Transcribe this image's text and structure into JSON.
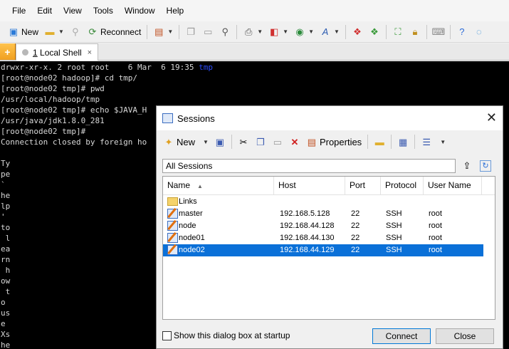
{
  "menubar": [
    "File",
    "Edit",
    "View",
    "Tools",
    "Window",
    "Help"
  ],
  "toolbar": {
    "new_label": "New",
    "reconnect_label": "Reconnect"
  },
  "tab": {
    "number": "1",
    "label": " Local Shell",
    "close": "×"
  },
  "terminal": {
    "lines": [
      "drwxr-xr-x. 2 root root    6 Mar  6 19:35 ",
      "[root@node02 hadoop]# cd tmp/",
      "[root@node02 tmp]# pwd",
      "/usr/local/hadoop/tmp",
      "[root@node02 tmp]# echo $JAVA_H",
      "/usr/java/jdk1.8.0_281",
      "[root@node02 tmp]#",
      "Connection closed by foreign ho"
    ],
    "dir_link": "tmp",
    "side_text": [
      "Ty",
      "pe",
      "`",
      "he",
      "lp",
      "'",
      "to",
      " l",
      "ea",
      "rn",
      " h",
      "ow",
      " t",
      "o",
      "us",
      "e",
      "Xs",
      "he"
    ]
  },
  "dialog": {
    "title": "Sessions",
    "close": "✕",
    "toolbar": {
      "new_label": "New",
      "properties_label": "Properties"
    },
    "path": "All Sessions",
    "columns": [
      "Name",
      "Host",
      "Port",
      "Protocol",
      "User Name"
    ],
    "folders": [
      {
        "name": "Links"
      }
    ],
    "sessions": [
      {
        "name": "master",
        "host": "192.168.5.128",
        "port": "22",
        "protocol": "SSH",
        "user": "root"
      },
      {
        "name": "node",
        "host": "192.168.44.128",
        "port": "22",
        "protocol": "SSH",
        "user": "root"
      },
      {
        "name": "node01",
        "host": "192.168.44.130",
        "port": "22",
        "protocol": "SSH",
        "user": "root"
      },
      {
        "name": "node02",
        "host": "192.168.44.129",
        "port": "22",
        "protocol": "SSH",
        "user": "root",
        "selected": true
      }
    ],
    "startup_checkbox": {
      "label": "Show this dialog box at startup",
      "checked": false
    },
    "connect_label": "Connect",
    "close_label": "Close"
  },
  "colors": {
    "selection": "#0a70d8",
    "terminal_bg": "#000000",
    "dir_color": "#2a4bff"
  }
}
